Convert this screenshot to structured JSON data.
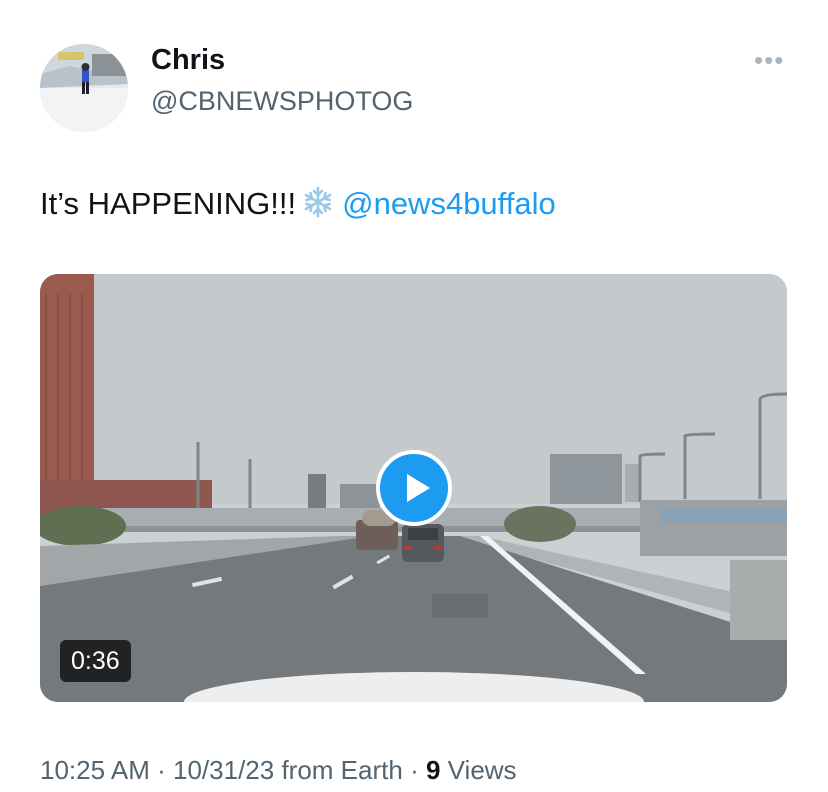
{
  "author": {
    "name": "Chris",
    "handle": "@CBNEWSPHOTOG",
    "avatar_icon": "avatar"
  },
  "more_icon": "more-options-icon",
  "tweet": {
    "text": "It’s HAPPENING!!!",
    "emoji": "snowflake-icon",
    "mention": "@news4buffalo"
  },
  "video": {
    "duration": "0:36",
    "play_icon": "play-icon",
    "accent_color": "#1d9bf0"
  },
  "meta": {
    "time": "10:25 AM",
    "sep1": "·",
    "date": "10/31/23",
    "source": "from Earth",
    "sep2": "·",
    "views_count": "9",
    "views_label": "Views"
  }
}
